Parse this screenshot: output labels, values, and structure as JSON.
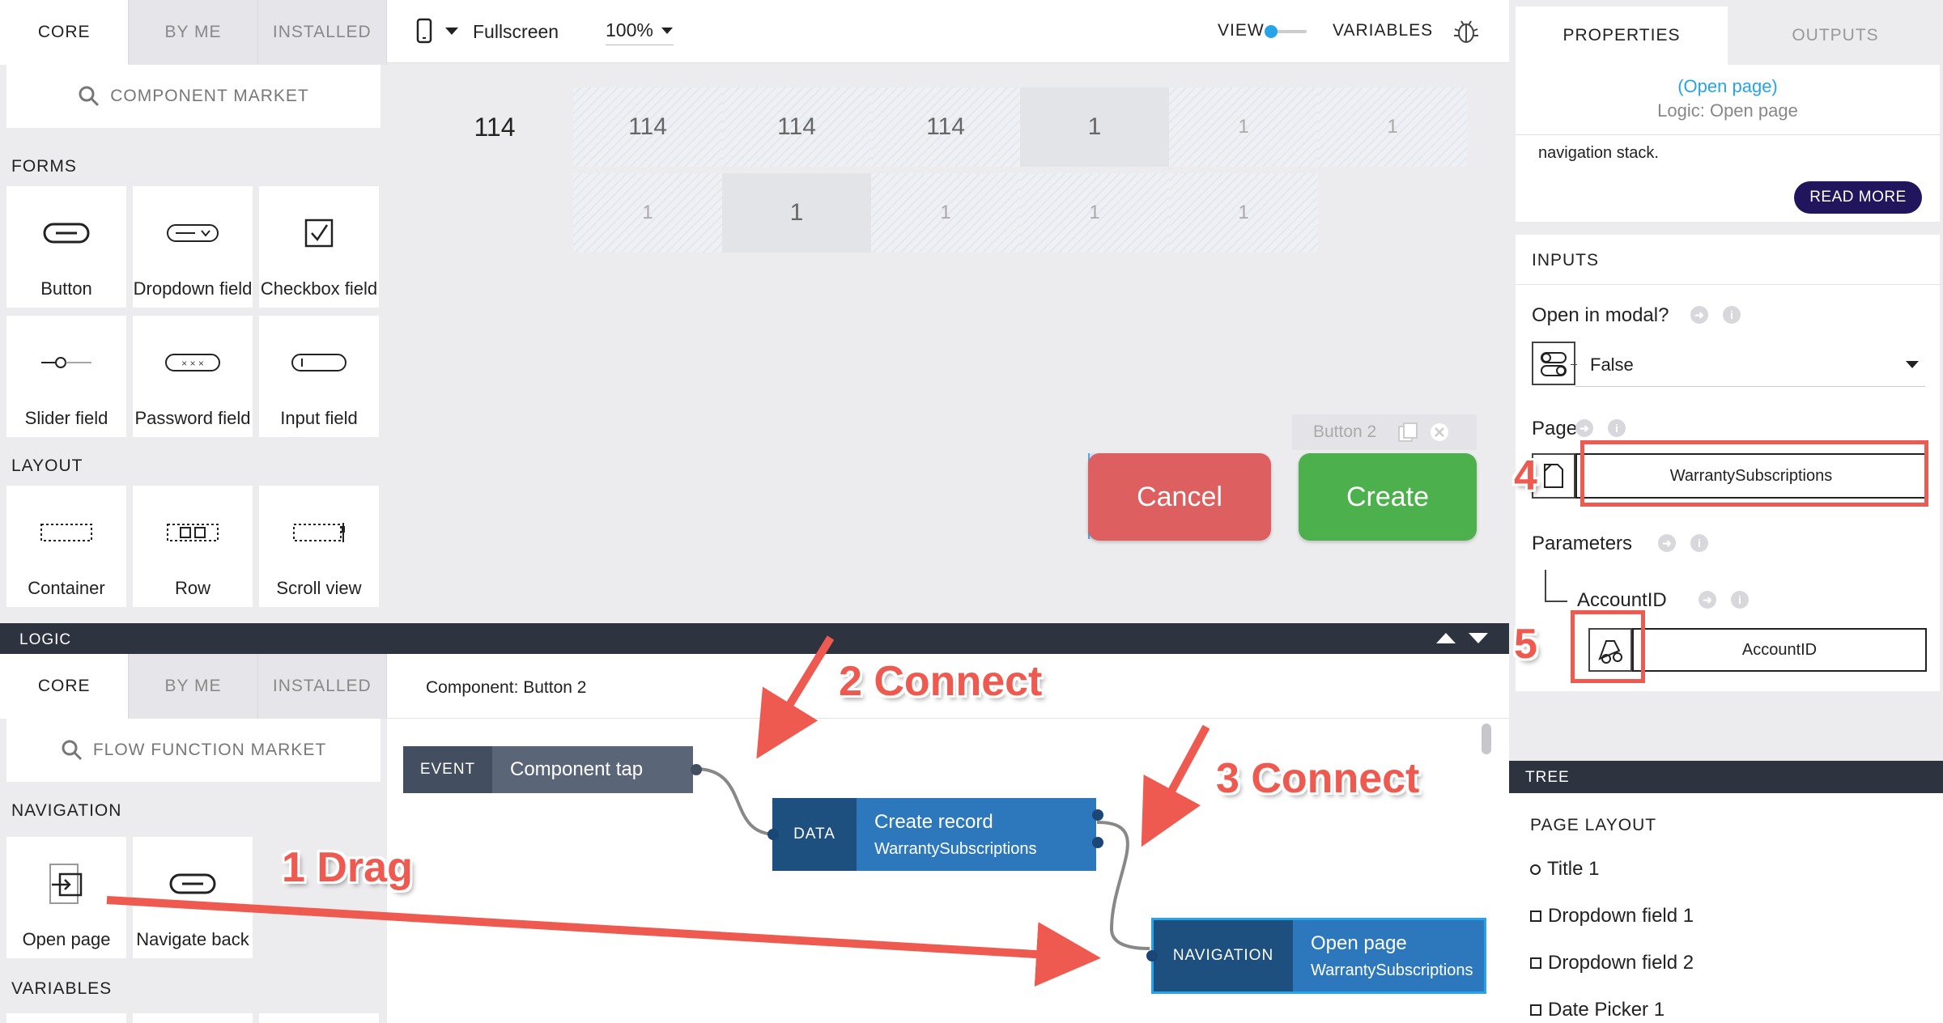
{
  "left_panel": {
    "tabs": [
      "CORE",
      "BY ME",
      "INSTALLED"
    ],
    "market_label": "COMPONENT MARKET",
    "forms_heading": "FORMS",
    "forms": [
      "Button",
      "Dropdown field",
      "Checkbox field",
      "Slider field",
      "Password field",
      "Input field"
    ],
    "layout_heading": "LAYOUT",
    "layout": [
      "Container",
      "Row",
      "Scroll view"
    ]
  },
  "toolbar": {
    "device": "Fullscreen",
    "zoom": "100%",
    "view_label": "VIEW",
    "variables_label": "VARIABLES"
  },
  "canvas": {
    "row1": [
      "114",
      "114",
      "114",
      "114",
      "1",
      "1",
      "1"
    ],
    "row2": [
      "1",
      "1",
      "1",
      "1",
      "1"
    ],
    "selected_label": "Button 2",
    "cancel_label": "Cancel",
    "create_label": "Create"
  },
  "logic": {
    "bar_title": "LOGIC",
    "tabs": [
      "CORE",
      "BY ME",
      "INSTALLED"
    ],
    "market_label": "FLOW FUNCTION MARKET",
    "navigation_heading": "NAVIGATION",
    "navigation": [
      "Open page",
      "Navigate back"
    ],
    "variables_heading": "VARIABLES",
    "component_title": "Component: Button 2",
    "nodes": {
      "event_tag": "EVENT",
      "event_label": "Component tap",
      "data_tag": "DATA",
      "data_label": "Create record",
      "data_sub": "WarrantySubscriptions",
      "nav_tag": "NAVIGATION",
      "nav_label": "Open page",
      "nav_sub": "WarrantySubscriptions"
    }
  },
  "annotations": {
    "drag": "1 Drag",
    "connect2": "2 Connect",
    "connect3": "3 Connect",
    "n4": "4",
    "n5": "5"
  },
  "right_panel": {
    "tabs": [
      "PROPERTIES",
      "OUTPUTS"
    ],
    "link": "(Open page)",
    "subtitle": "Logic: Open page",
    "desc": "navigation stack.",
    "read_more": "READ MORE",
    "inputs_heading": "INPUTS",
    "modal_label": "Open in modal?",
    "modal_value": "False",
    "page_label": "Page",
    "page_value": "WarrantySubscriptions",
    "params_label": "Parameters",
    "account_label": "AccountID",
    "account_value": "AccountID"
  },
  "tree": {
    "bar_title": "TREE",
    "heading": "PAGE LAYOUT",
    "items": [
      "Title 1",
      "Dropdown field 1",
      "Dropdown field 2",
      "Date Picker 1"
    ]
  },
  "colors": {
    "cancel": "#dd5f5f",
    "create": "#4cb04c",
    "node_dark": "#1d4f7f",
    "node_light": "#2d78bd",
    "event_dark": "#434e60",
    "event_light": "#5a6578",
    "accent": "#ee5a4f",
    "read_more": "#21165d"
  }
}
